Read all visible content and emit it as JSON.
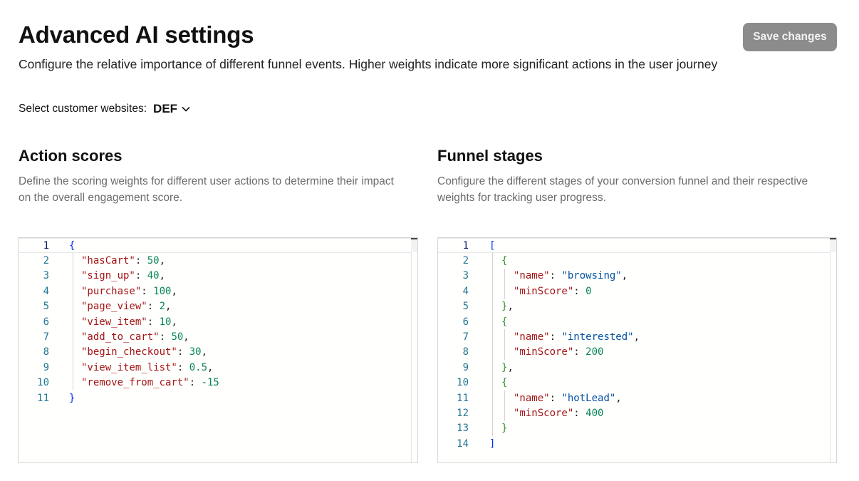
{
  "header": {
    "title": "Advanced AI settings",
    "subtitle": "Configure the relative importance of different funnel events. Higher weights indicate more significant actions in the user journey",
    "save_label": "Save changes"
  },
  "site_selector": {
    "label": "Select customer websites:",
    "value": "DEF",
    "icon": "chevron-down-icon"
  },
  "action_scores": {
    "title": "Action scores",
    "description_line1": "Define the scoring weights for different user actions to determine their impact",
    "description_line2": "on the overall engagement score.",
    "editor": {
      "open": "{",
      "close": "}",
      "entries": [
        {
          "key": "\"hasCart\"",
          "value": "50",
          "comma": ","
        },
        {
          "key": "\"sign_up\"",
          "value": "40",
          "comma": ","
        },
        {
          "key": "\"purchase\"",
          "value": "100",
          "comma": ","
        },
        {
          "key": "\"page_view\"",
          "value": "2",
          "comma": ","
        },
        {
          "key": "\"view_item\"",
          "value": "10",
          "comma": ","
        },
        {
          "key": "\"add_to_cart\"",
          "value": "50",
          "comma": ","
        },
        {
          "key": "\"begin_checkout\"",
          "value": "30",
          "comma": ","
        },
        {
          "key": "\"view_item_list\"",
          "value": "0.5",
          "comma": ","
        },
        {
          "key": "\"remove_from_cart\"",
          "value": "-15",
          "comma": ""
        }
      ],
      "line_numbers": [
        "1",
        "2",
        "3",
        "4",
        "5",
        "6",
        "7",
        "8",
        "9",
        "10",
        "11"
      ]
    }
  },
  "funnel_stages": {
    "title": "Funnel stages",
    "description_line1": "Configure the different stages of your conversion funnel and their respective",
    "description_line2": "weights for tracking user progress.",
    "editor": {
      "open": "[",
      "close": "]",
      "name_key": "\"name\"",
      "min_key": "\"minScore\"",
      "stages": [
        {
          "name": "\"browsing\"",
          "minScore": "0",
          "comma": ","
        },
        {
          "name": "\"interested\"",
          "minScore": "200",
          "comma": ","
        },
        {
          "name": "\"hotLead\"",
          "minScore": "400",
          "comma": ""
        }
      ],
      "line_numbers": [
        "1",
        "2",
        "3",
        "4",
        "5",
        "6",
        "7",
        "8",
        "9",
        "10",
        "11",
        "12",
        "13",
        "14"
      ]
    }
  },
  "colors": {
    "key": "#a31515",
    "number": "#098658",
    "string": "#0451a5",
    "bracket_outer": "#0431fa",
    "bracket_inner": "#319331",
    "line_number": "#237893",
    "button_bg": "#8c8c8c"
  }
}
